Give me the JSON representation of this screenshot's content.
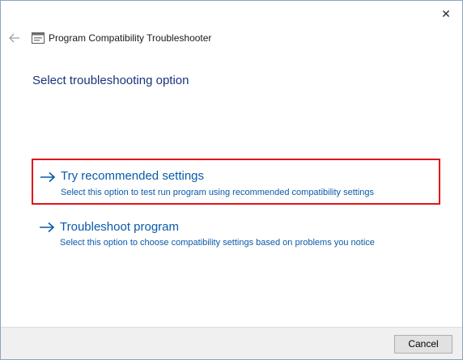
{
  "window": {
    "title": "Program Compatibility Troubleshooter",
    "close_glyph": "✕"
  },
  "heading": "Select troubleshooting option",
  "options": [
    {
      "title": "Try recommended settings",
      "description": "Select this option to test run program using recommended compatibility settings",
      "highlighted": true
    },
    {
      "title": "Troubleshoot program",
      "description": "Select this option to choose compatibility settings based on problems you notice",
      "highlighted": false
    }
  ],
  "footer": {
    "cancel_label": "Cancel"
  },
  "colors": {
    "link": "#0a5aa8",
    "heading": "#19337a",
    "highlight_border": "#e0151b",
    "footer_bg": "#f0f0f0"
  },
  "icons": {
    "back": "back-arrow-icon",
    "app": "troubleshooter-app-icon",
    "option_arrow": "right-arrow-icon",
    "close": "close-icon"
  }
}
